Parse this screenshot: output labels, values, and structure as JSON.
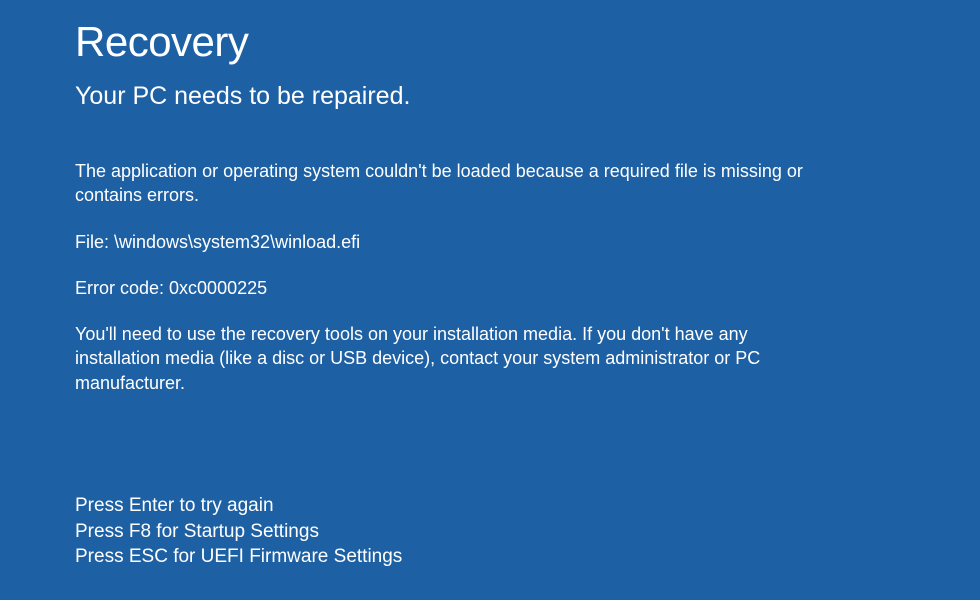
{
  "title": "Recovery",
  "subtitle": "Your PC needs to be repaired.",
  "body": {
    "reason": "The application or operating system couldn't be loaded because a required file is missing or contains errors.",
    "file_line": "File: \\windows\\system32\\winload.efi",
    "error_line": "Error code: 0xc0000225",
    "instructions": "You'll need to use the recovery tools on your installation media. If you don't have any installation media (like a disc or USB device), contact your system administrator or PC manufacturer."
  },
  "prompts": {
    "enter": "Press Enter to try again",
    "f8": "Press F8 for Startup Settings",
    "esc": "Press ESC for UEFI Firmware Settings"
  }
}
